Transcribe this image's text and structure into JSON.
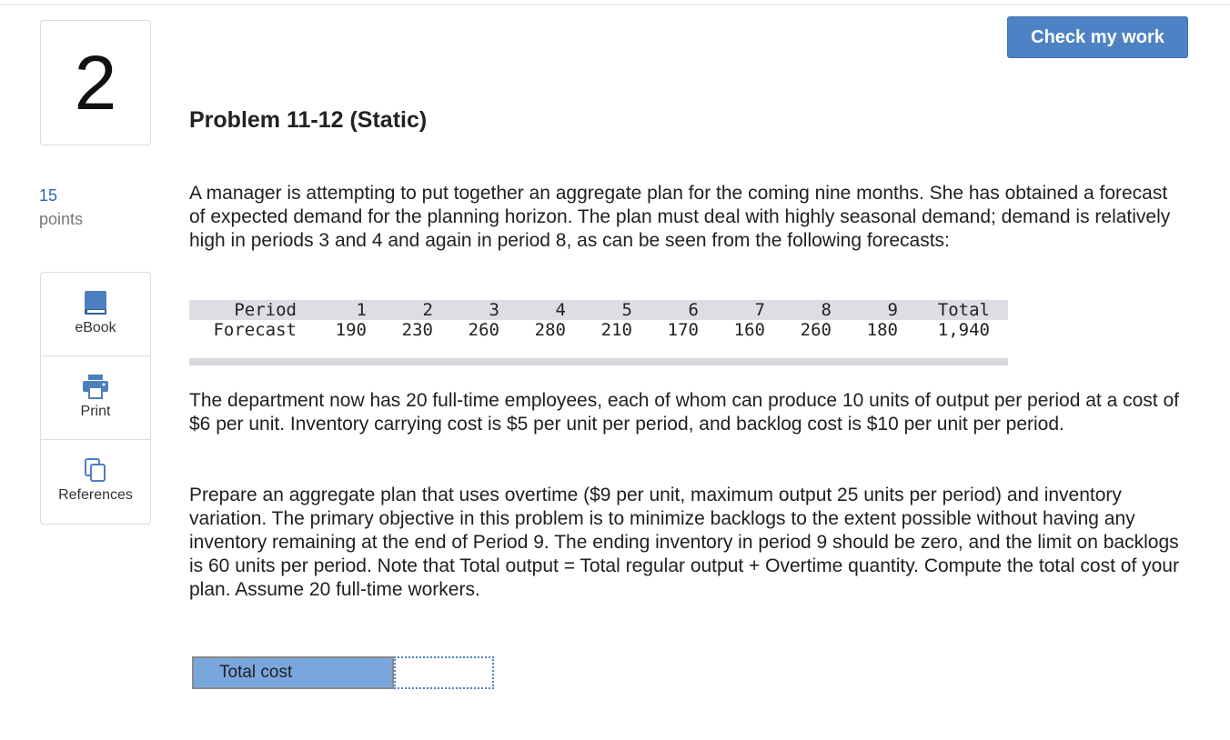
{
  "question": {
    "number": "2",
    "title": "Problem 11-12 (Static)",
    "points_value": "15",
    "points_label": "points"
  },
  "header": {
    "check_label": "Check my work"
  },
  "tools": [
    {
      "label": "eBook",
      "icon": "book-icon"
    },
    {
      "label": "Print",
      "icon": "printer-icon"
    },
    {
      "label": "References",
      "icon": "copy-icon"
    }
  ],
  "intro": "A manager is attempting to put together an aggregate plan for the coming nine months. She has obtained a forecast of expected demand for the planning horizon. The plan must deal with highly seasonal demand; demand is relatively high in periods 3 and 4 and again in period 8, as can be seen from the following forecasts:",
  "forecast_table": {
    "row_labels": [
      "Period",
      "Forecast"
    ],
    "periods": [
      "1",
      "2",
      "3",
      "4",
      "5",
      "6",
      "7",
      "8",
      "9",
      "Total"
    ],
    "forecast": [
      "190",
      "230",
      "260",
      "280",
      "210",
      "170",
      "160",
      "260",
      "180",
      "1,940"
    ]
  },
  "para2": "The department now has 20 full-time employees, each of whom can produce 10 units of output per period at a cost of $6 per unit. Inventory carrying cost is $5 per unit per period, and backlog cost is $10 per unit per period.",
  "para3": "Prepare an aggregate plan that uses overtime ($9 per unit, maximum output 25 units per period) and inventory variation. The primary objective in this problem is to minimize backlogs to the extent possible without having any inventory remaining at the end of Period 9. The ending inventory in period 9 should be zero, and the limit on backlogs is 60 units per period. Note that Total output = Total regular output + Overtime quantity. Compute the total cost of your plan. Assume 20 full-time workers.",
  "answer": {
    "label": "Total cost",
    "value": ""
  },
  "colors": {
    "accent": "#4d83c4",
    "label_bg": "#7aa6de",
    "points": "#2a67b0"
  }
}
